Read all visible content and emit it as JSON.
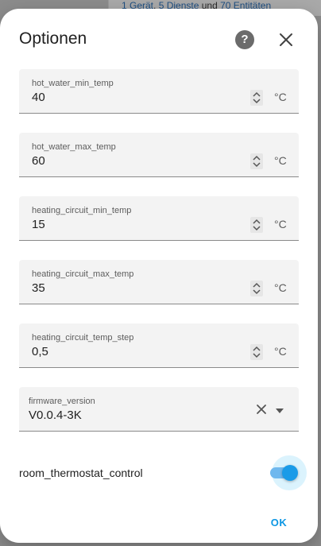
{
  "background": {
    "link_parts": [
      "1 Gerät",
      ", ",
      "5 Dienste",
      " und ",
      "70 Entitäten"
    ]
  },
  "dialog": {
    "title": "Optionen",
    "help_icon": "help-circle-icon",
    "close_icon": "close-icon"
  },
  "fields": [
    {
      "label": "hot_water_min_temp",
      "value": "40",
      "unit": "°C"
    },
    {
      "label": "hot_water_max_temp",
      "value": "60",
      "unit": "°C"
    },
    {
      "label": "heating_circuit_min_temp",
      "value": "15",
      "unit": "°C"
    },
    {
      "label": "heating_circuit_max_temp",
      "value": "35",
      "unit": "°C"
    },
    {
      "label": "heating_circuit_temp_step",
      "value": "0,5",
      "unit": "°C"
    }
  ],
  "select": {
    "label": "firmware_version",
    "value": "V0.0.4-3K"
  },
  "toggle": {
    "label": "room_thermostat_control",
    "checked": true
  },
  "actions": {
    "ok_label": "OK"
  },
  "colors": {
    "accent": "#1a9be8",
    "field_bg": "#f3f3f3"
  }
}
